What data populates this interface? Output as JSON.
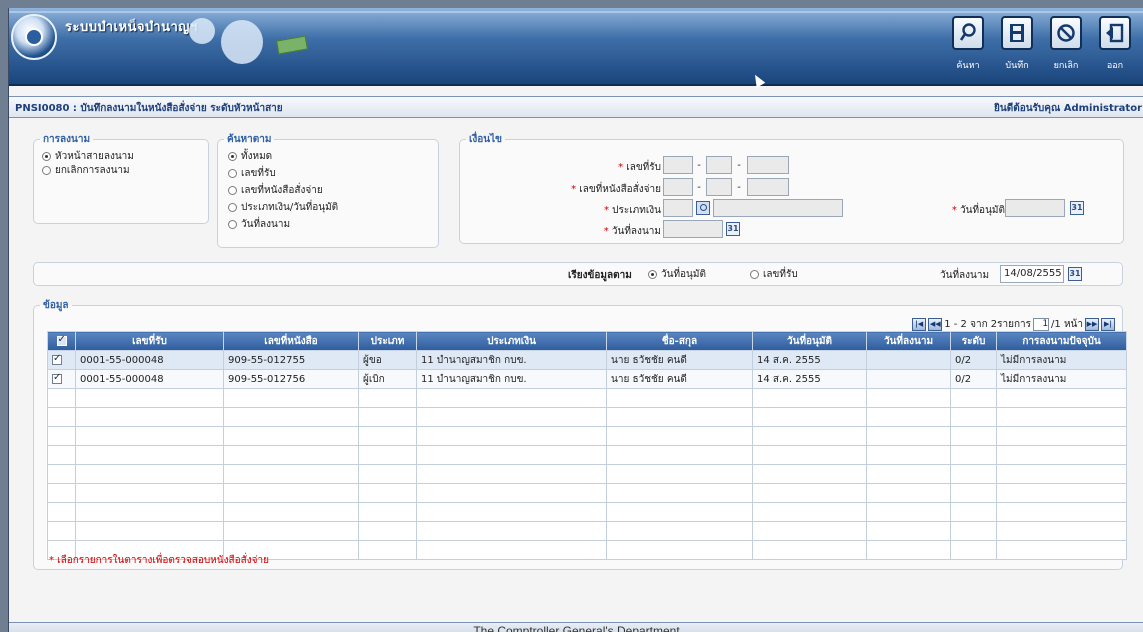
{
  "app": {
    "title": "ระบบบำเหน็จบำนาญฯ",
    "toolbar": [
      {
        "name": "search",
        "label": "ค้นหา",
        "icon": "search-icon"
      },
      {
        "name": "save",
        "label": "บันทึก",
        "icon": "save-icon"
      },
      {
        "name": "cancel",
        "label": "ยกเลิก",
        "icon": "cancel-icon"
      },
      {
        "name": "exit",
        "label": "ออก",
        "icon": "exit-icon"
      }
    ]
  },
  "page": {
    "code_title": "PNSI0080 : บันทึกลงนามในหนังสือสั่งจ่าย ระดับหัวหน้าสาย",
    "welcome": "ยินดีต้อนรับคุณ Administrator"
  },
  "signing": {
    "legend": "การลงนาม",
    "options": [
      {
        "label": "หัวหน้าสายลงนาม",
        "selected": true
      },
      {
        "label": "ยกเลิกการลงนาม",
        "selected": false
      }
    ]
  },
  "search_by": {
    "legend": "ค้นหาตาม",
    "options": [
      {
        "label": "ทั้งหมด",
        "selected": true
      },
      {
        "label": "เลขที่รับ",
        "selected": false
      },
      {
        "label": "เลขที่หนังสือสั่งจ่าย",
        "selected": false
      },
      {
        "label": "ประเภทเงิน/วันที่อนุมัติ",
        "selected": false
      },
      {
        "label": "วันที่ลงนาม",
        "selected": false
      }
    ]
  },
  "conditions": {
    "legend": "เงื่อนไข",
    "receipt_no_label": "เลขที่รับ",
    "order_no_label": "เลขที่หนังสือสั่งจ่าย",
    "money_type_label": "ประเภทเงิน",
    "sign_date_label": "วันที่ลงนาม",
    "approve_date_label": "วันที่อนุมัติ",
    "required_mark": "*",
    "separator": "-",
    "calendar_icon_text": "31"
  },
  "sort": {
    "label": "เรียงข้อมูลตาม",
    "options": [
      {
        "label": "วันที่อนุมัติ",
        "selected": true
      },
      {
        "label": "เลขที่รับ",
        "selected": false
      }
    ],
    "sign_date_label": "วันที่ลงนาม",
    "sign_date_value": "14/08/2555"
  },
  "data_section": {
    "legend": "ข้อมูล",
    "pager": {
      "range_text": "1 - 2 จาก 2รายการ",
      "page_value": "1",
      "page_suffix": "/1 หน้า"
    },
    "columns": [
      "เลขที่รับ",
      "เลขที่หนังสือ",
      "ประเภท",
      "ประเภทเงิน",
      "ชื่อ-สกุล",
      "วันที่อนุมัติ",
      "วันที่ลงนาม",
      "ระดับ",
      "การลงนามปัจจุบัน"
    ],
    "rows": [
      {
        "checked": true,
        "receipt_no": "0001-55-000048",
        "doc_no": "909-55-012755",
        "type": "ผู้ขอ",
        "money_type": "11 บำนาญสมาชิก กบข.",
        "name": "นาย ธวัชชัย คนดี",
        "approve_date": "14 ส.ค. 2555",
        "sign_date": "",
        "level": "0/2",
        "status": "ไม่มีการลงนาม"
      },
      {
        "checked": true,
        "receipt_no": "0001-55-000048",
        "doc_no": "909-55-012756",
        "type": "ผู้เบิก",
        "money_type": "11 บำนาญสมาชิก กบข.",
        "name": "นาย ธวัชชัย คนดี",
        "approve_date": "14 ส.ค. 2555",
        "sign_date": "",
        "level": "0/2",
        "status": "ไม่มีการลงนาม"
      }
    ],
    "footnote": "* เลือกรายการในตารางเพื่อตรวจสอบหนังสือสั่งจ่าย"
  },
  "footer": "The Comptroller General's Department"
}
